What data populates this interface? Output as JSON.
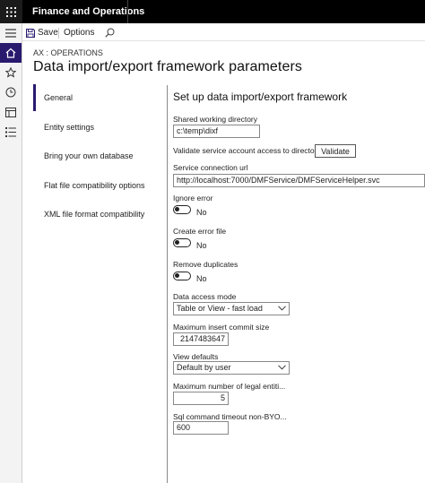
{
  "app": {
    "name": "Finance and Operations"
  },
  "actionbar": {
    "save_label": "Save",
    "options_label": "Options"
  },
  "breadcrumb": "AX : OPERATIONS",
  "page_title": "Data import/export framework parameters",
  "tabs": [
    {
      "label": "General",
      "selected": true
    },
    {
      "label": "Entity settings"
    },
    {
      "label": "Bring your own database"
    },
    {
      "label": "Flat file compatibility options"
    },
    {
      "label": "XML file format compatibility"
    }
  ],
  "section_title": "Set up data import/export framework",
  "fields": {
    "shared_dir": {
      "label": "Shared working directory",
      "value": "c:\\temp\\dixf"
    },
    "validate": {
      "label": "Validate service account access to directory",
      "button": "Validate"
    },
    "service_url": {
      "label": "Service connection url",
      "value": "http://localhost:7000/DMFService/DMFServiceHelper.svc"
    },
    "ignore_error": {
      "label": "Ignore error",
      "value": "No"
    },
    "create_error_file": {
      "label": "Create error file",
      "value": "No"
    },
    "remove_duplicates": {
      "label": "Remove duplicates",
      "value": "No"
    },
    "data_access_mode": {
      "label": "Data access mode",
      "value": "Table or View - fast load"
    },
    "max_insert_commit": {
      "label": "Maximum insert commit size",
      "value": "2147483647"
    },
    "view_defaults": {
      "label": "View defaults",
      "value": "Default by user"
    },
    "max_legal_entities": {
      "label": "Maximum number of legal entiti...",
      "value": "5"
    },
    "sql_timeout": {
      "label": "Sql command timeout non-BYO...",
      "value": "600"
    }
  },
  "colors": {
    "accent": "#2a1a6e",
    "topbar": "#000000"
  }
}
